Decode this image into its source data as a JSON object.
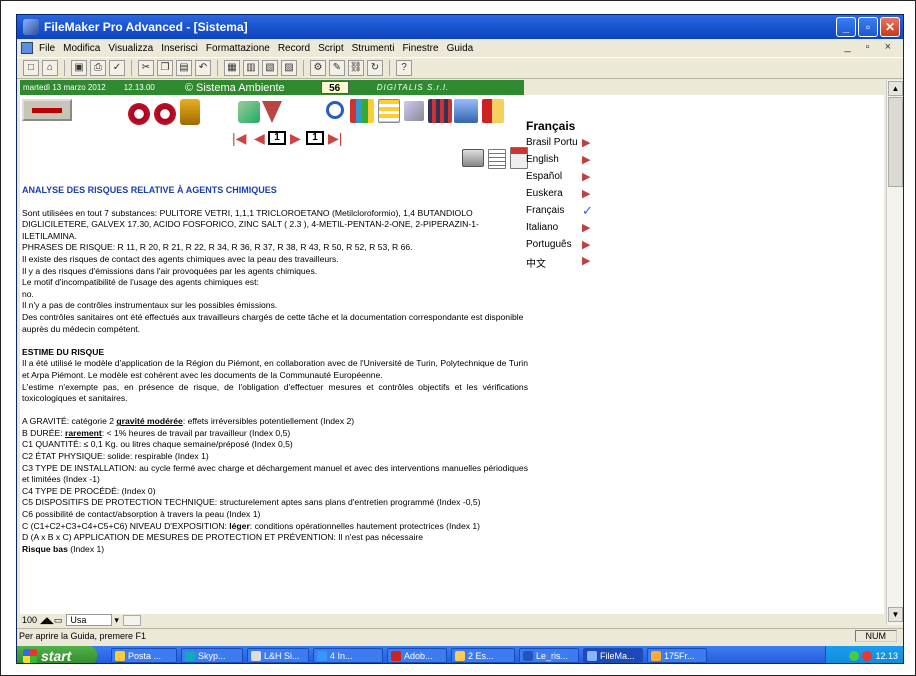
{
  "window": {
    "title": "FileMaker Pro Advanced - [Sistema]",
    "controls": [
      "minimize",
      "maximize",
      "close"
    ]
  },
  "menubar": {
    "items": [
      "File",
      "Modifica",
      "Visualizza",
      "Inserisci",
      "Formattazione",
      "Record",
      "Script",
      "Strumenti",
      "Finestre",
      "Guida"
    ],
    "right_controls": "_ ▫ ×"
  },
  "toolbar": {
    "icons": [
      "new-icon",
      "open-icon",
      "save-icon",
      "print-icon",
      "spellcheck-icon",
      "cut-icon",
      "copy-icon",
      "paste-icon",
      "undo-icon",
      "layout-icon",
      "table-icon",
      "field-icon",
      "chart-icon",
      "tool-icon",
      "script-icon",
      "link-icon",
      "sync-icon",
      "help-icon"
    ]
  },
  "infobar": {
    "date": "martedì 13 marzo 2012",
    "time": "12.13.00",
    "app_name": "© Sistema Ambiente",
    "counter": "56",
    "company": "DIGITALIS S.r.l."
  },
  "nav": {
    "page_current": "1",
    "page_total": "1"
  },
  "languages": {
    "selected": "Français",
    "items": [
      {
        "label": "Brasil Portu",
        "selected": false
      },
      {
        "label": "English",
        "selected": false
      },
      {
        "label": "Español",
        "selected": false
      },
      {
        "label": "Euskera",
        "selected": false
      },
      {
        "label": "Français",
        "selected": true
      },
      {
        "label": "Italiano",
        "selected": false
      },
      {
        "label": "Português",
        "selected": false
      },
      {
        "label": "中文",
        "selected": false
      }
    ]
  },
  "document": {
    "heading": "ANALYSE DES RISQUES RELATIVE À AGENTS CHIMIQUES",
    "p1": "Sont utilisées en tout 7 substances: PULITORE VETRI, 1,1,1 TRICLOROETANO (Metilcloroformio), 1,4 BUTANDIOLO DIGLICILETERE, GALVEX 17.30, ACIDO FOSFORICO, ZINC SALT ( 2.3 ), 4-METIL-PENTAN-2-ONE, 2-PIPERAZIN-1-ILETILAMINA.",
    "p2": "PHRASES DE RISQUE: R 11, R 20, R 21, R 22, R 34, R 36, R 37, R 38, R 43, R 50, R 52, R 53, R 66.",
    "p3": "Il existe des risques de contact des agents chimiques avec la peau des travailleurs.",
    "p4": "Il y a des risques d'émissions dans l'air provoquées par les agents chimiques.",
    "p5": "Le motif d'incompatibilité de l'usage des agents chimiques est:",
    "p6": "no.",
    "p7": "Il n'y a pas de contrôles instrumentaux sur les possibles émissions.",
    "p8": "Des contrôles sanitaires ont été effectués aux travailleurs chargés de cette tâche et la documentation correspondante est disponible auprès du médecin compétent.",
    "subheading": "ESTIME DU RISQUE",
    "p9": "Il a été utilisé le modèle d'application de la Région du Piémont, en collaboration avec de l'Université de Turin, Polytechnique de Turin et Arpa Piémont. Le modèle est cohérent avec les documents de la Communauté Européenne.",
    "p10": "L'estime n'exempte pas, en présence de risque, de l'obligation d'effectuer mesures et contrôles objectifs  et les vérifications toxicologiques et sanitaires.",
    "a_pre": "A GRAVITÉ: catégorie 2 ",
    "a_bold": "gravité modérée",
    "a_post": ": effets irréversibles potentiellement (Index 2)",
    "b_pre": "B DURÉE: ",
    "b_bold": "rarement",
    "b_post": ": < 1% heures de travail par travailleur (Index 0,5)",
    "c1": "C1 QUANTITÉ: ≤ 0,1 Kg. ou litres chaque semaine/préposé (Index 0,5)",
    "c2": "C2 ÉTAT PHYSIQUE: solide: respirable (Index 1)",
    "c3": "C3 TYPE DE INSTALLATION: au cycle fermé avec charge et déchargement manuel et avec des interventions manuelles périodiques et limitées (Index -1)",
    "c4": "C4 TYPE DE PROCÉDÉ:  (Index 0)",
    "c5": "C5 DISPOSITIFS DE PROTECTION TECHNIQUE: structurelement aptes sans plans d'entretien programmé (Index -0,5)",
    "c6": "C6 possibilité de contact/absorption à travers la peau (Index 1)",
    "c_pre": "C  (C1+C2+C3+C4+C5+C6) NIVEAU D'EXPOSITION: ",
    "c_bold": "léger",
    "c_post": ": conditions opérationnelles hautement protectrices (Index 1)",
    "d": "D (A x B x C) APPLICATION DE MESURES DE PROTECTION ET PRÉVENTION: Il n'est pas nécessaire",
    "e_bold": "Risque bas",
    "e_post": " (Index 1)"
  },
  "zoombar": {
    "zoom": "100",
    "mode": "Usa"
  },
  "statusbar": {
    "hint": "Per aprire la Guida, premere F1",
    "num": "NUM"
  },
  "taskbar": {
    "start": "start",
    "tasks": [
      "Posta ...",
      "Skyp...",
      "L&H Si...",
      "4 In...",
      "Adob...",
      "2 Es...",
      "Le_ris...",
      "FileMa...",
      "175Fr..."
    ],
    "clock": "12.13"
  },
  "colors": {
    "title_blue": "#1b55d0",
    "info_green": "#2f8a2f",
    "heading_blue": "#1a3fb0",
    "language_arrow": "#c04040",
    "check_blue": "#3355ff"
  }
}
